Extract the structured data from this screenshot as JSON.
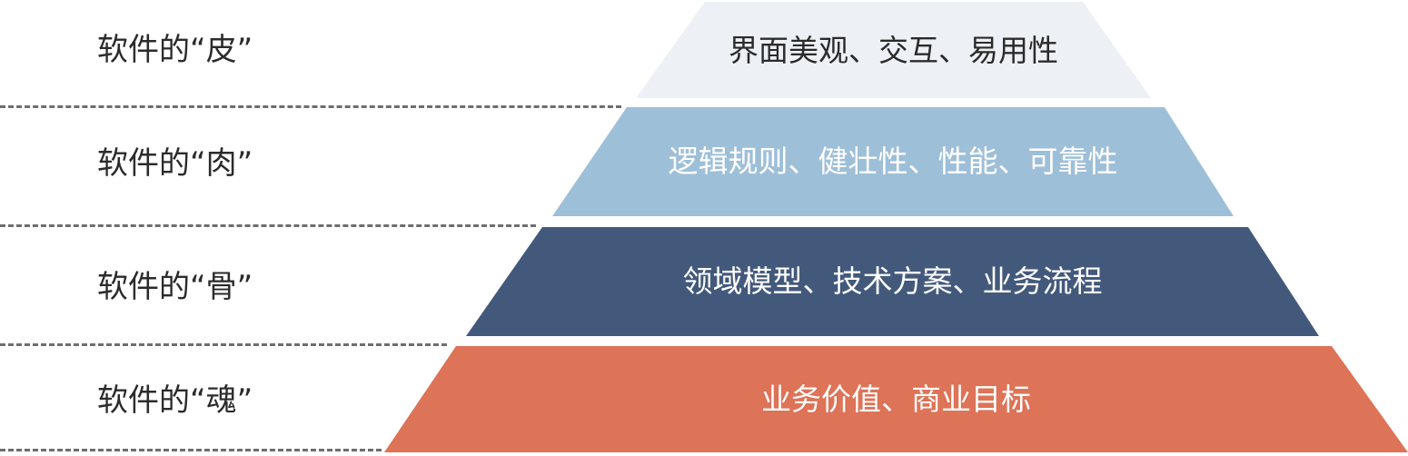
{
  "rows": [
    {
      "label": "软件的“皮”",
      "content": "界面美观、交互、易用性",
      "fill": "#edf0f4",
      "text_color": "#2b2b2b"
    },
    {
      "label": "软件的“肉”",
      "content": "逻辑规则、健壮性、性能、可靠性",
      "fill": "#9ebfd8",
      "text_color": "#ffffff"
    },
    {
      "label": "软件的“骨”",
      "content": "领域模型、技术方案、业务流程",
      "fill": "#43597c",
      "text_color": "#ffffff"
    },
    {
      "label": "软件的“魂”",
      "content": "业务价值、商业目标",
      "fill": "#dd7357",
      "text_color": "#ffffff"
    }
  ],
  "colors": {
    "divider": "#6e6e6e",
    "label_text": "#2b2b2b"
  }
}
